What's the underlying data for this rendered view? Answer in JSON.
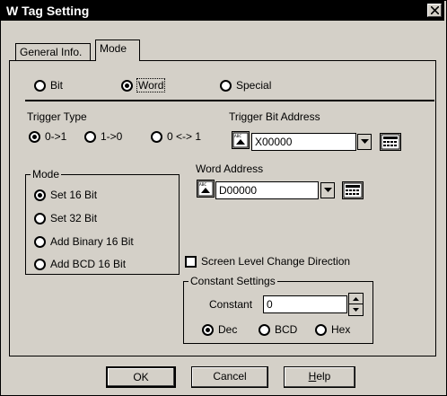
{
  "window": {
    "title": "W Tag Setting"
  },
  "tabs": [
    {
      "label": "General Info."
    },
    {
      "label": "Mode"
    }
  ],
  "data_type": {
    "options": [
      {
        "label": "Bit",
        "selected": false
      },
      {
        "label": "Word",
        "selected": true
      },
      {
        "label": "Special",
        "selected": false
      }
    ]
  },
  "trigger_type": {
    "label": "Trigger Type",
    "options": [
      {
        "label": "0->1",
        "selected": true
      },
      {
        "label": "1->0",
        "selected": false
      },
      {
        "label": "0 <-> 1",
        "selected": false
      }
    ]
  },
  "trigger_bit_address": {
    "label": "Trigger Bit Address",
    "value": "X00000"
  },
  "mode": {
    "title": "Mode",
    "options": [
      {
        "label": "Set 16 Bit",
        "selected": true
      },
      {
        "label": "Set 32 Bit",
        "selected": false
      },
      {
        "label": "Add Binary 16 Bit",
        "selected": false
      },
      {
        "label": "Add BCD 16 Bit",
        "selected": false
      }
    ]
  },
  "word_address": {
    "label": "Word Address",
    "value": "D00000"
  },
  "screen_level": {
    "label": "Screen Level Change Direction",
    "checked": false
  },
  "constant_settings": {
    "title": "Constant Settings",
    "constant_label": "Constant",
    "constant_value": "0",
    "format_options": [
      {
        "label": "Dec",
        "selected": true
      },
      {
        "label": "BCD",
        "selected": false
      },
      {
        "label": "Hex",
        "selected": false
      }
    ]
  },
  "buttons": {
    "ok": "OK",
    "cancel": "Cancel",
    "help": "Help"
  }
}
